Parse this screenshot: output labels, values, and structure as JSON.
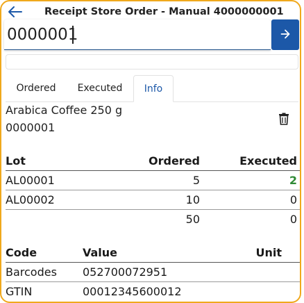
{
  "header": {
    "title": "Receipt Store Order - Manual 4000000001"
  },
  "scan": {
    "value": "0000001"
  },
  "tabs": [
    {
      "label": "Ordered"
    },
    {
      "label": "Executed"
    },
    {
      "label": "Info"
    }
  ],
  "active_tab": "Info",
  "product": {
    "name": "Arabica Coffee 250 g",
    "code": "0000001"
  },
  "lots_table": {
    "headers": {
      "lot": "Lot",
      "ordered": "Ordered",
      "executed": "Executed"
    },
    "rows": [
      {
        "lot": "AL00001",
        "ordered": "5",
        "executed": "2"
      },
      {
        "lot": "AL00002",
        "ordered": "10",
        "executed": "0"
      },
      {
        "lot": "",
        "ordered": "50",
        "executed": "0"
      }
    ]
  },
  "codes_table": {
    "headers": {
      "code": "Code",
      "value": "Value",
      "unit": "Unit"
    },
    "rows": [
      {
        "code": "Barcodes",
        "value": "052700072951",
        "unit": ""
      },
      {
        "code": "GTIN",
        "value": "00012345600012",
        "unit": ""
      }
    ]
  },
  "colors": {
    "accent": "#1c58a8",
    "executed_positive": "#2f8a35",
    "frame_border": "#f0a81c"
  },
  "icons": {
    "back": "arrow-left-icon",
    "go": "arrow-right-icon",
    "delete": "trash-icon"
  }
}
